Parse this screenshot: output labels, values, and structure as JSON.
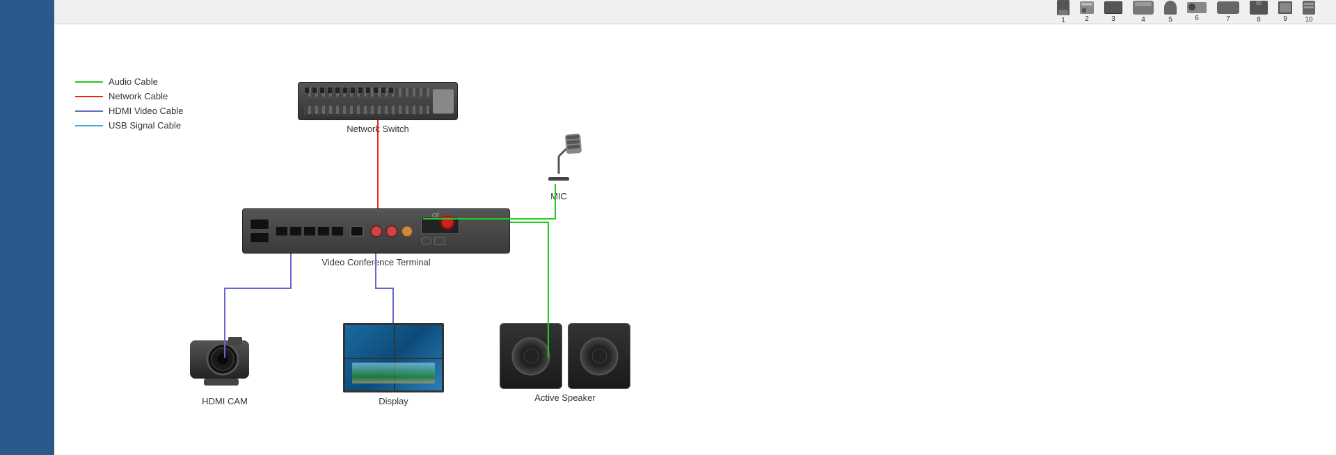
{
  "legend": {
    "items": [
      {
        "label": "Audio Cable",
        "color": "#22cc22"
      },
      {
        "label": "Network Cable",
        "color": "#ee2222"
      },
      {
        "label": "HDMI Video Cable",
        "color": "#6666cc"
      },
      {
        "label": "USB Signal Cable",
        "color": "#44aacc"
      }
    ]
  },
  "devices": {
    "network_switch": {
      "label": "Network Switch"
    },
    "vct": {
      "label": "Video Conference Terminal"
    },
    "mic": {
      "label": "MIC"
    },
    "camera": {
      "label": "HDMI CAM"
    },
    "display": {
      "label": "Display"
    },
    "speaker": {
      "label": "Active Speaker"
    }
  },
  "toolbar": {
    "numbers": [
      "1",
      "2",
      "3",
      "4",
      "5",
      "6",
      "7",
      "8",
      "9",
      "10"
    ]
  }
}
